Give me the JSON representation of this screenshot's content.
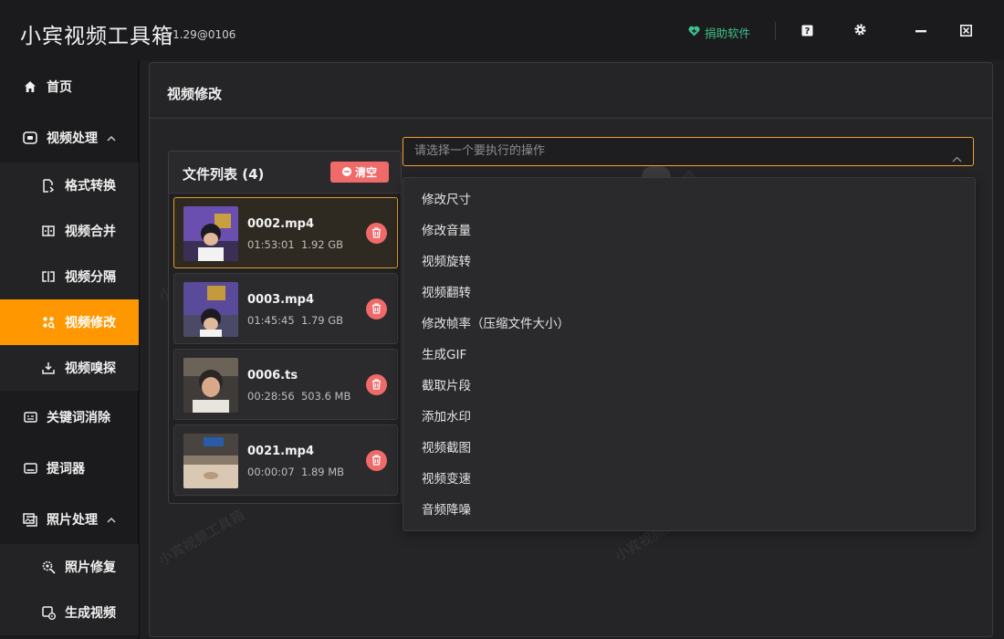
{
  "app": {
    "title": "小宾视频工具箱",
    "version": "v1.29@0106",
    "donate_label": "捐助软件",
    "accent_color": "#ff9800",
    "danger_color": "#f06a6a",
    "donate_color": "#3fbf8a"
  },
  "titlebar_icons": [
    "help-icon",
    "gear-icon",
    "minimize-icon",
    "close-icon"
  ],
  "sidebar": {
    "items": [
      {
        "label": "首页",
        "icon": "home-icon",
        "level": "top"
      },
      {
        "label": "视频处理",
        "icon": "video-icon",
        "level": "top",
        "expanded": true
      },
      {
        "label": "格式转换",
        "icon": "file-convert-icon",
        "level": "sub"
      },
      {
        "label": "视频合并",
        "icon": "merge-icon",
        "level": "sub"
      },
      {
        "label": "视频分隔",
        "icon": "split-icon",
        "level": "sub"
      },
      {
        "label": "视频修改",
        "icon": "edit-nodes-icon",
        "level": "sub",
        "active": true
      },
      {
        "label": "视频嗅探",
        "icon": "download-icon",
        "level": "sub"
      },
      {
        "label": "关键词消除",
        "icon": "keyword-icon",
        "level": "top"
      },
      {
        "label": "提词器",
        "icon": "prompter-icon",
        "level": "top"
      },
      {
        "label": "照片处理",
        "icon": "photo-icon",
        "level": "top",
        "expanded": true
      },
      {
        "label": "照片修复",
        "icon": "photo-repair-icon",
        "level": "sub"
      },
      {
        "label": "生成视频",
        "icon": "generate-video-icon",
        "level": "sub"
      }
    ]
  },
  "main": {
    "title": "视频修改",
    "file_list": {
      "title": "文件列表 (4)",
      "clear_label": "清空",
      "files": [
        {
          "name": "0002.mp4",
          "duration": "01:53:01",
          "size": "1.92 GB",
          "selected": true
        },
        {
          "name": "0003.mp4",
          "duration": "01:45:45",
          "size": "1.79 GB"
        },
        {
          "name": "0006.ts",
          "duration": "00:28:56",
          "size": "503.6 MB"
        },
        {
          "name": "0021.mp4",
          "duration": "00:00:07",
          "size": "1.89 MB"
        }
      ]
    },
    "operation_select": {
      "placeholder": "请选择一个要执行的操作",
      "options": [
        "修改尺寸",
        "修改音量",
        "视频旋转",
        "视频翻转",
        "修改帧率（压缩文件大小）",
        "生成GIF",
        "截取片段",
        "添加水印",
        "视频截图",
        "视频变速",
        "音频降噪"
      ]
    }
  },
  "watermark_text": "小宾视频工具箱"
}
